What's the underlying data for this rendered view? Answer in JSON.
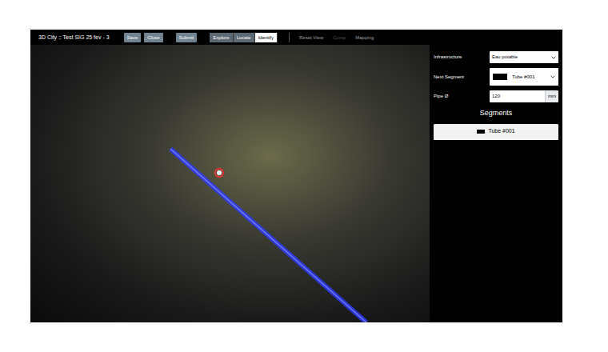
{
  "window": {
    "title": "3D City :: Test SIG 25 fev - 3"
  },
  "toolbar": {
    "actions": [
      {
        "label": "Save"
      },
      {
        "label": "Close"
      }
    ],
    "submit": {
      "label": "Submit"
    },
    "modes": [
      {
        "label": "Explore",
        "selected": false
      },
      {
        "label": "Locate",
        "selected": false
      },
      {
        "label": "Identify",
        "selected": true
      }
    ],
    "links": [
      {
        "label": "Reset View",
        "disabled": false
      },
      {
        "label": "Comp",
        "disabled": true
      },
      {
        "label": "Mapping",
        "disabled": false
      }
    ]
  },
  "form": {
    "infrastructure": {
      "label": "Infrastructure",
      "value": "Eau potable"
    },
    "next_segment": {
      "label": "Next Segment",
      "value": "Tube #001",
      "color": "#000000"
    },
    "pipe_diameter": {
      "label": "Pipe Ø",
      "value": "120",
      "unit": "mm"
    }
  },
  "segments": {
    "title": "Segments",
    "items": [
      {
        "label": "Tube #001",
        "color": "#000000",
        "selected": false
      }
    ]
  }
}
